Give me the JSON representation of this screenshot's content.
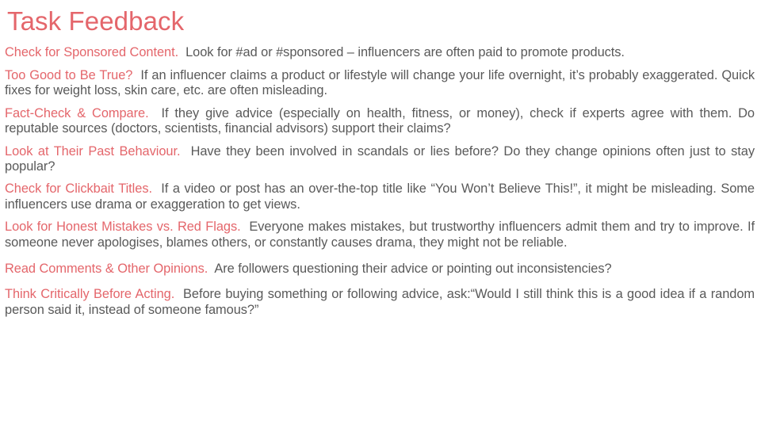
{
  "slide": {
    "title": "Task Feedback",
    "colors": {
      "accent_red": "#e4666b",
      "body_text": "#595959",
      "background": "#ffffff"
    }
  },
  "paragraphs": [
    {
      "lead": "Check for Sponsored Content.",
      "body": "Look for #ad or #sponsored – influencers are often paid to promote products."
    },
    {
      "lead": "Too Good to Be True?",
      "body": "If an influencer claims a product or lifestyle will change your life overnight, it’s probably exaggerated.  Quick fixes for weight loss, skin care, etc. are often misleading."
    },
    {
      "lead": "Fact-Check & Compare.",
      "body": "If they give advice (especially on health, fitness, or money), check if experts agree with them.  Do reputable sources (doctors, scientists, financial advisors) support their claims?"
    },
    {
      "lead": "Look at Their Past Behaviour.",
      "body": "Have they been involved in scandals or lies before?  Do they change opinions often just to stay popular?"
    },
    {
      "lead": "Check for Clickbait Titles.",
      "body": "If a video or post has an over-the-top title like “You Won’t Believe This!”, it might be misleading.  Some influencers use drama or exaggeration to get views."
    },
    {
      "lead": "Look for Honest Mistakes vs. Red Flags.",
      "body": "Everyone makes mistakes, but trustworthy influencers admit them and try to improve.  If someone never apologises, blames others, or constantly causes drama, they might not be reliable."
    },
    {
      "lead": "Read Comments & Other Opinions.",
      "body": "Are followers questioning their advice or pointing out inconsistencies?"
    },
    {
      "lead": "Think Critically Before Acting.",
      "body": "Before buying something or following advice, ask:“Would I still think this is a good idea if a random person said it, instead of someone famous?”"
    }
  ]
}
